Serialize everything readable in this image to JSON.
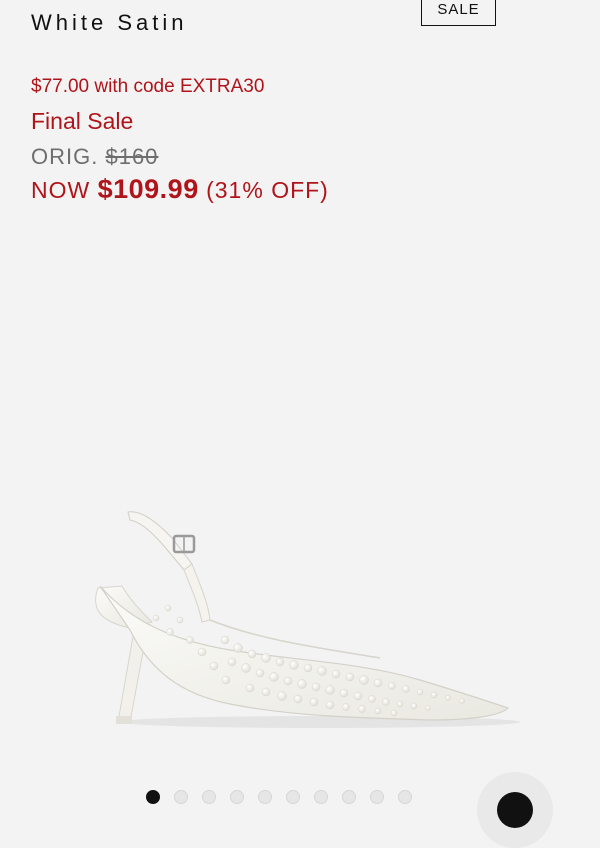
{
  "product": {
    "color_name": "White Satin",
    "sale_badge": "SALE",
    "promo_text": "$77.00 with code EXTRA30",
    "final_sale": "Final Sale",
    "orig_label": "ORIG.",
    "orig_price": "$160",
    "now_label": "NOW",
    "now_price": "$109.99",
    "discount": "(31% OFF)",
    "image_icon": "pearl-slingback-pump-image"
  },
  "carousel": {
    "total_slides": 10,
    "active_index": 0
  },
  "colors": {
    "sale_red": "#b0141b",
    "text_dark": "#111111",
    "text_gray": "#6e6e6e",
    "background": "#f3f3f3"
  }
}
